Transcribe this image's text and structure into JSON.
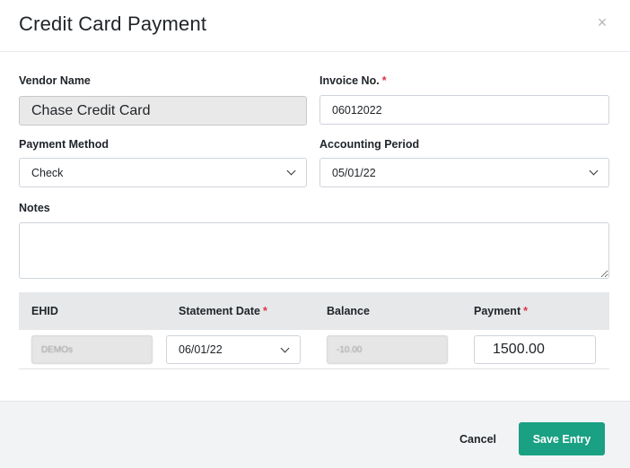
{
  "modal": {
    "title": "Credit Card Payment",
    "close_label": "×"
  },
  "form": {
    "vendor_name": {
      "label": "Vendor Name",
      "value": "Chase Credit Card"
    },
    "invoice_no": {
      "label": "Invoice No.",
      "required_mark": "*",
      "value": "06012022"
    },
    "payment_method": {
      "label": "Payment Method",
      "value": "Check"
    },
    "accounting_period": {
      "label": "Accounting Period",
      "value": "05/01/22"
    },
    "notes": {
      "label": "Notes",
      "value": ""
    }
  },
  "table": {
    "headers": {
      "ehid": "EHID",
      "statement_date": "Statement Date",
      "balance": "Balance",
      "payment": "Payment",
      "required_mark": "*"
    },
    "row": {
      "ehid": "DEMOs",
      "statement_date": "06/01/22",
      "balance": "-10.00",
      "payment": "1500.00"
    }
  },
  "footer": {
    "cancel_label": "Cancel",
    "save_label": "Save Entry"
  },
  "colors": {
    "accent": "#1aa083",
    "required": "#dc3545"
  }
}
